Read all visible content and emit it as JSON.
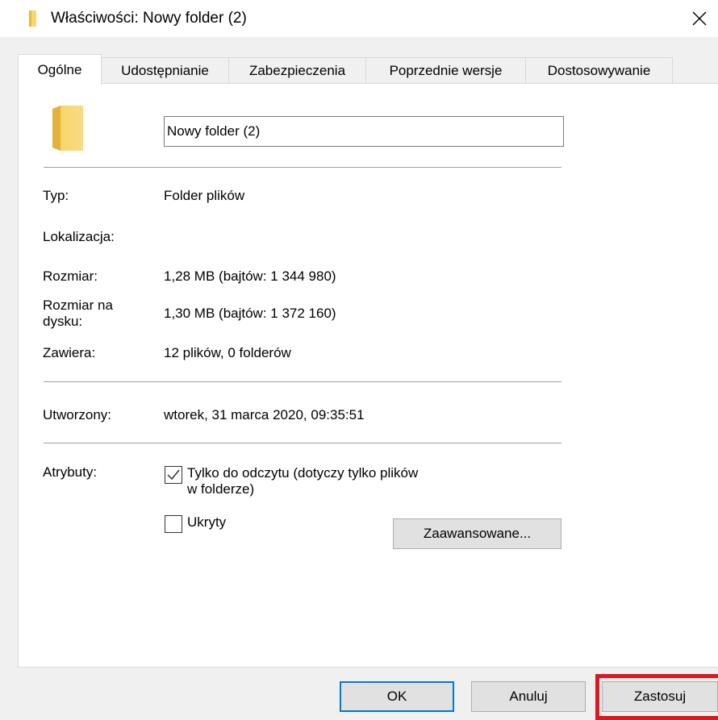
{
  "window": {
    "title": "Właściwości: Nowy folder (2)",
    "close_glyph": "✕",
    "folder_color": "#f7d774"
  },
  "tabs": [
    {
      "label": "Ogólne",
      "active": true
    },
    {
      "label": "Udostępnianie",
      "active": false
    },
    {
      "label": "Zabezpieczenia",
      "active": false
    },
    {
      "label": "Poprzednie wersje",
      "active": false
    },
    {
      "label": "Dostosowywanie",
      "active": false
    }
  ],
  "general": {
    "folder_name": "Nowy folder (2)",
    "type_label": "Typ:",
    "type_value": "Folder plików",
    "location_label": "Lokalizacja:",
    "location_value": "",
    "size_label": "Rozmiar:",
    "size_value": "1,28 MB (bajtów: 1 344 980)",
    "size_on_disk_label": "Rozmiar na dysku:",
    "size_on_disk_value": "1,30 MB (bajtów: 1 372 160)",
    "contains_label": "Zawiera:",
    "contains_value": "12 plików, 0 folderów",
    "created_label": "Utworzony:",
    "created_value": "wtorek, 31 marca 2020, 09:35:51",
    "attributes_label": "Atrybuty:",
    "readonly_label": "Tylko do odczytu (dotyczy tylko plików w folderze)",
    "readonly_checked": true,
    "hidden_label": "Ukryty",
    "hidden_checked": false,
    "advanced_button": "Zaawansowane..."
  },
  "footer": {
    "ok_label": "OK",
    "cancel_label": "Anuluj",
    "apply_label": "Zastosuj",
    "highlight_color": "#e0161e"
  }
}
